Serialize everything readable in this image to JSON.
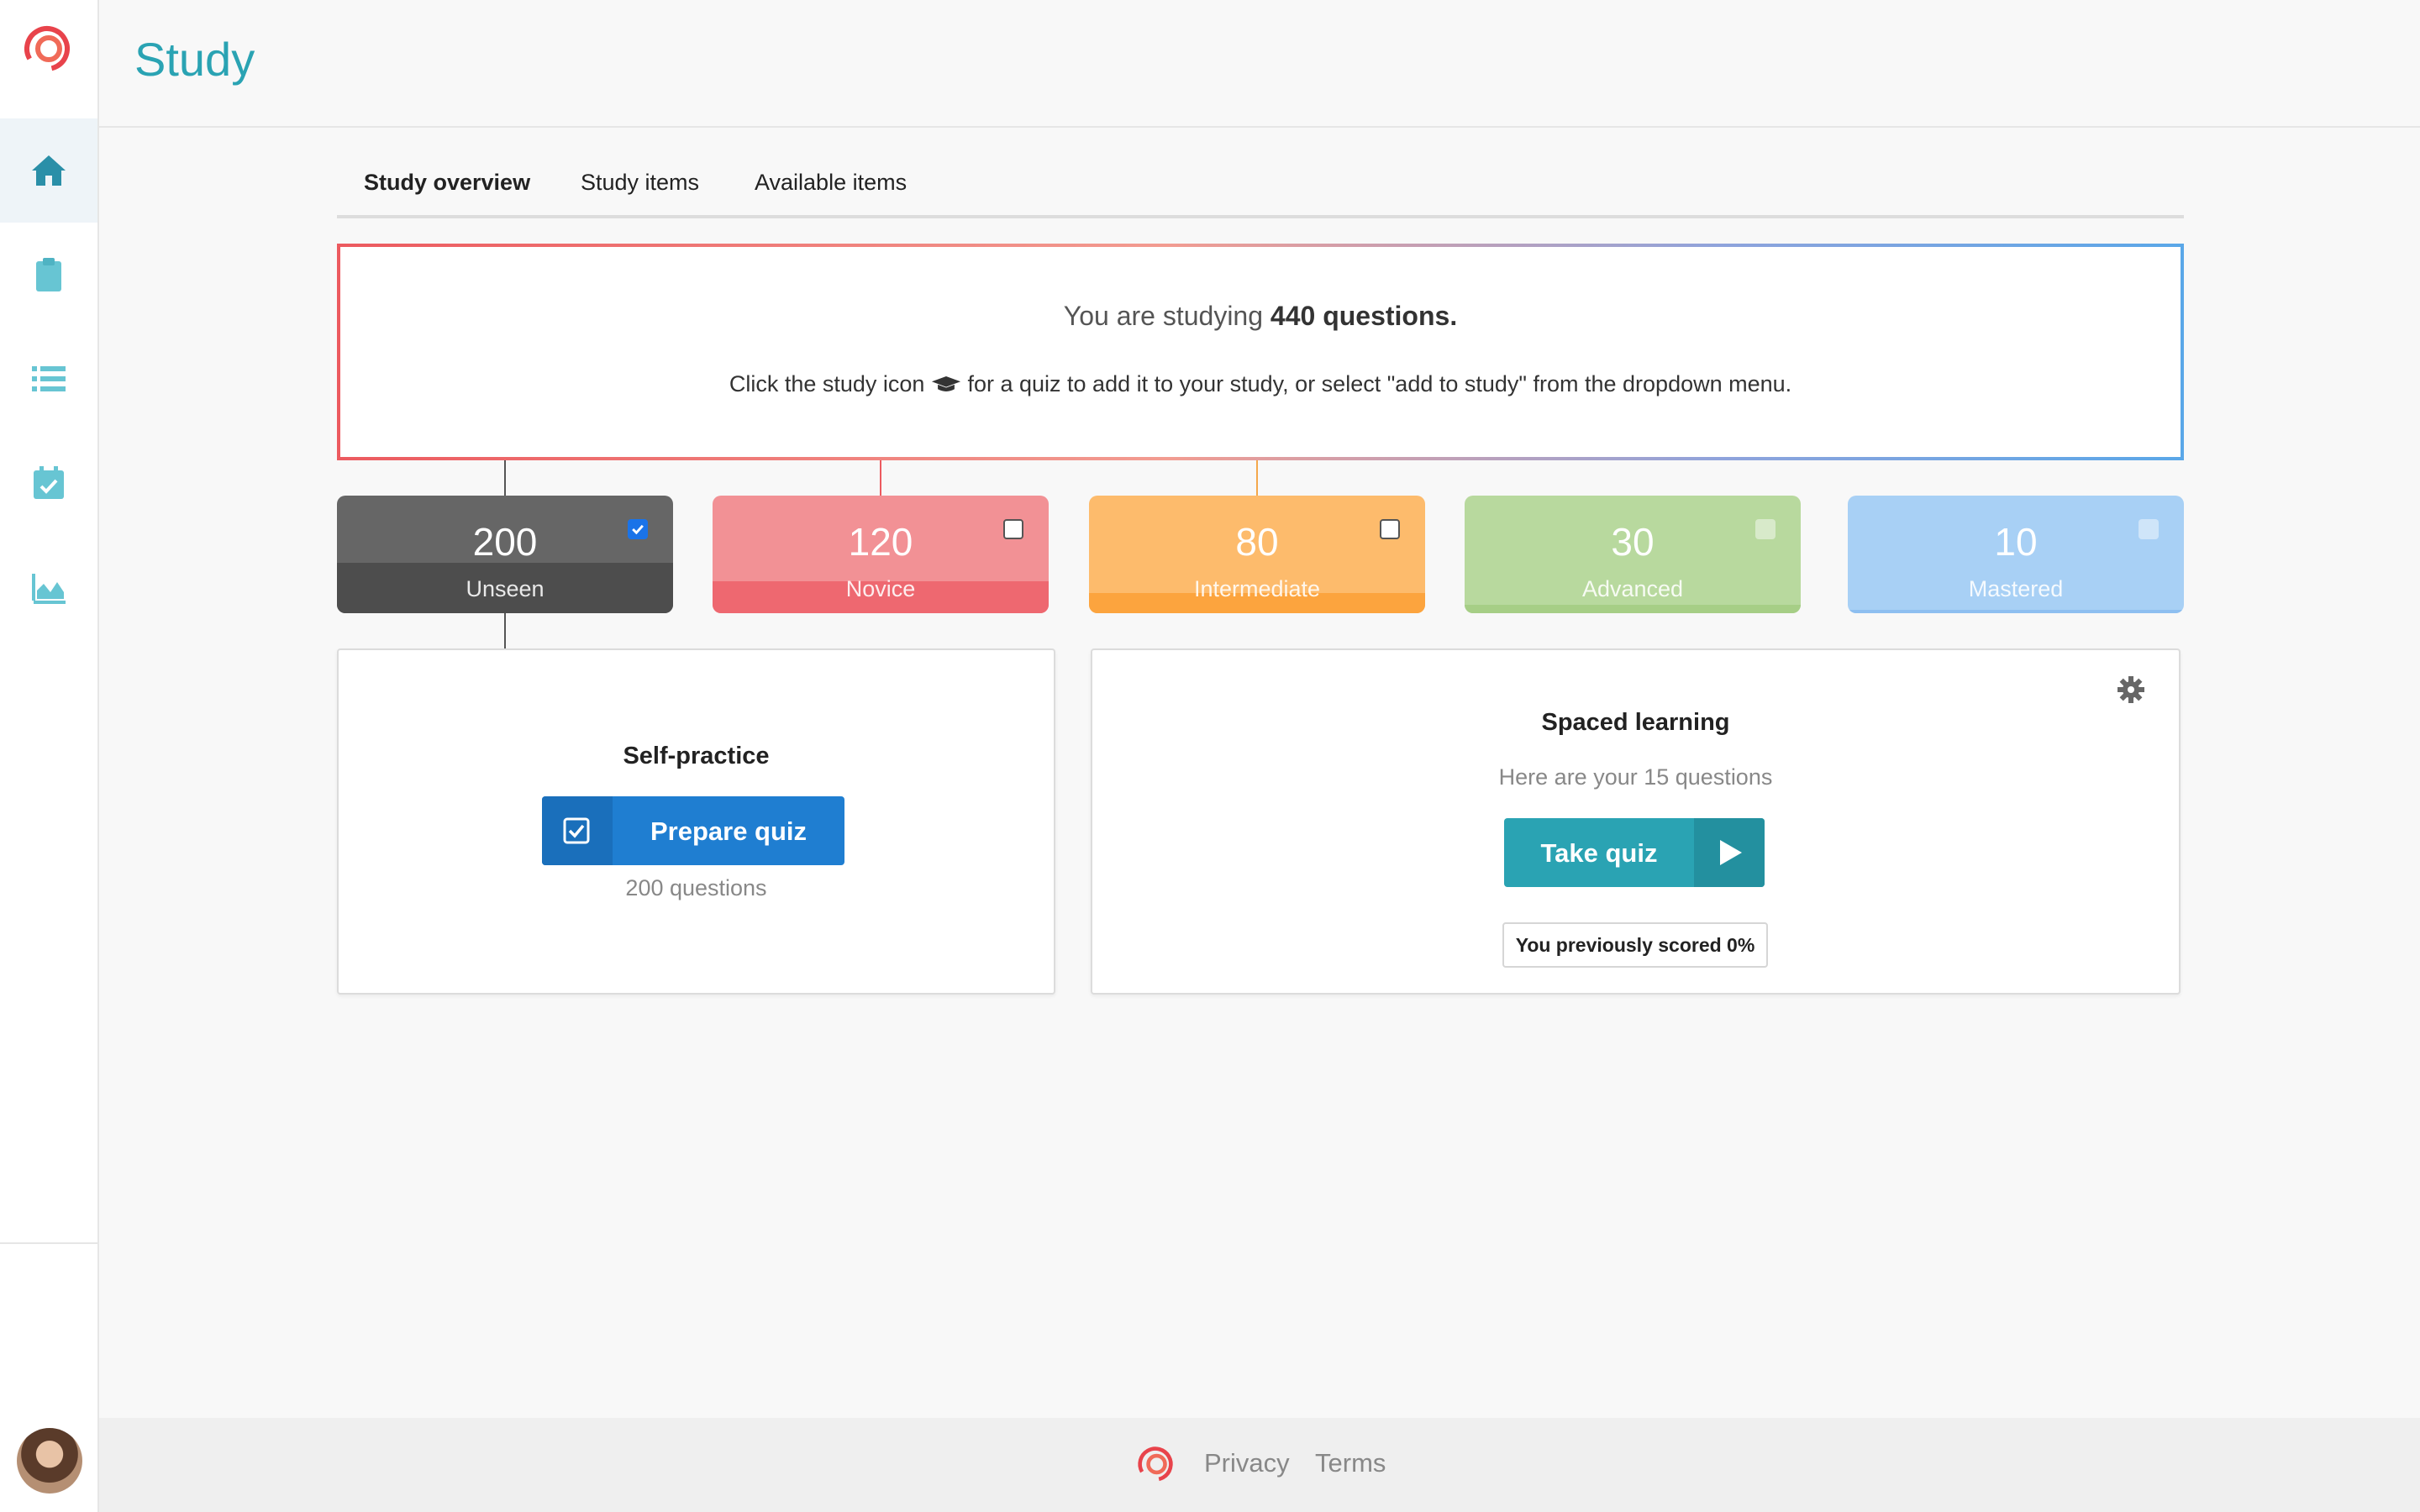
{
  "sidebar": {
    "items": [
      {
        "name": "home-icon",
        "active": true
      },
      {
        "name": "clipboard-icon",
        "active": false
      },
      {
        "name": "list-icon",
        "active": false
      },
      {
        "name": "calendar-check-icon",
        "active": false
      },
      {
        "name": "area-chart-icon",
        "active": false
      }
    ]
  },
  "header": {
    "title": "Study"
  },
  "tabs": [
    {
      "label": "Study overview",
      "active": true
    },
    {
      "label": "Study items",
      "active": false
    },
    {
      "label": "Available items",
      "active": false
    }
  ],
  "info": {
    "prefix": "You are studying ",
    "count_text": "440 questions.",
    "hint_before_icon": "Click the study icon",
    "hint_icon": "graduation-cap-icon",
    "hint_after_icon": "for a quiz to add it to your study, or select \"add to study\" from the dropdown menu."
  },
  "levels": [
    {
      "count": "200",
      "label": "Unseen",
      "checked": true,
      "color": "#666666",
      "band_color": "#4d4d4d"
    },
    {
      "count": "120",
      "label": "Novice",
      "checked": false,
      "color": "#f29195",
      "band_color": "#ee6870"
    },
    {
      "count": "80",
      "label": "Intermediate",
      "checked": false,
      "color": "#fdbb6c",
      "band_color": "#fca43e"
    },
    {
      "count": "30",
      "label": "Advanced",
      "checked": false,
      "color": "#b8d99e",
      "band_color": "#a6ce86"
    },
    {
      "count": "10",
      "label": "Mastered",
      "checked": false,
      "color": "#a8d0f5",
      "band_color": "#8ebff0"
    }
  ],
  "self_practice": {
    "title": "Self-practice",
    "button_label": "Prepare quiz",
    "button_icon": "check-square-icon",
    "subtitle": "200 questions"
  },
  "spaced_learning": {
    "title": "Spaced learning",
    "subtitle": "Here are your 15 questions",
    "button_label": "Take quiz",
    "button_icon": "play-icon",
    "score_text": "You previously scored 0%",
    "settings_icon": "gear-icon"
  },
  "footer": {
    "privacy": "Privacy",
    "terms": "Terms"
  },
  "colors": {
    "accent": "#2aa3b3",
    "primary_button": "#1f7ed1",
    "brand": "#e8434b"
  }
}
